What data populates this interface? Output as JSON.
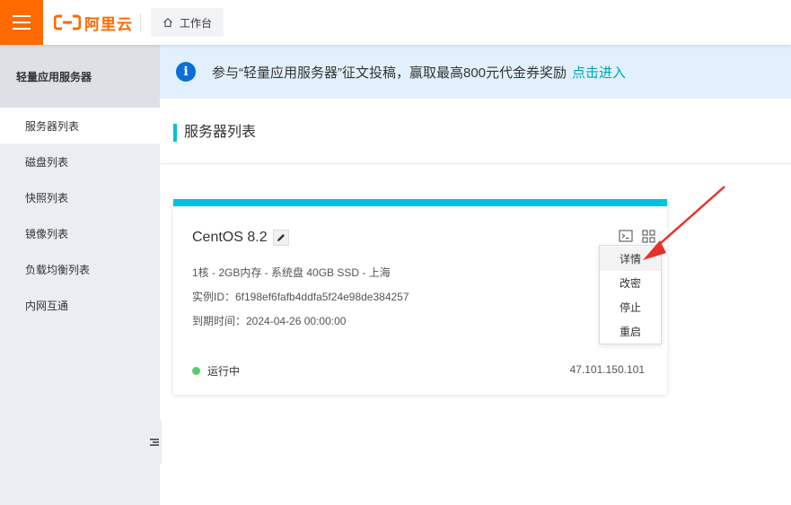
{
  "header": {
    "logo_text": "阿里云",
    "workbench_label": "工作台"
  },
  "sidebar": {
    "title": "轻量应用服务器",
    "items": [
      {
        "label": "服务器列表",
        "active": true
      },
      {
        "label": "磁盘列表"
      },
      {
        "label": "快照列表"
      },
      {
        "label": "镜像列表"
      },
      {
        "label": "负载均衡列表"
      },
      {
        "label": "内网互通"
      }
    ]
  },
  "banner": {
    "text": "参与“轻量应用服务器”征文投稿，赢取最高800元代金券奖励",
    "link": "点击进入"
  },
  "page": {
    "title": "服务器列表"
  },
  "server": {
    "name": "CentOS 8.2",
    "specs": "1核 - 2GB内存 - 系统盘 40GB SSD - 上海",
    "instance_id": "实例ID：6f198ef6fafb4ddfa5f24e98de384257",
    "expire": "到期时间：2024-04-26 00:00:00",
    "status": "运行中",
    "ip": "47.101.150.101"
  },
  "dropdown": {
    "items": [
      "详情",
      "改密",
      "停止",
      "重启"
    ]
  },
  "colors": {
    "brand": "#ff6a00",
    "accent": "#00c1de",
    "status_running": "#5cc96d",
    "annotation_arrow": "#e8302a"
  },
  "icons": [
    "menu-icon",
    "home-icon",
    "info-icon",
    "edit-icon",
    "terminal-icon",
    "grid-icon",
    "collapse-icon"
  ]
}
